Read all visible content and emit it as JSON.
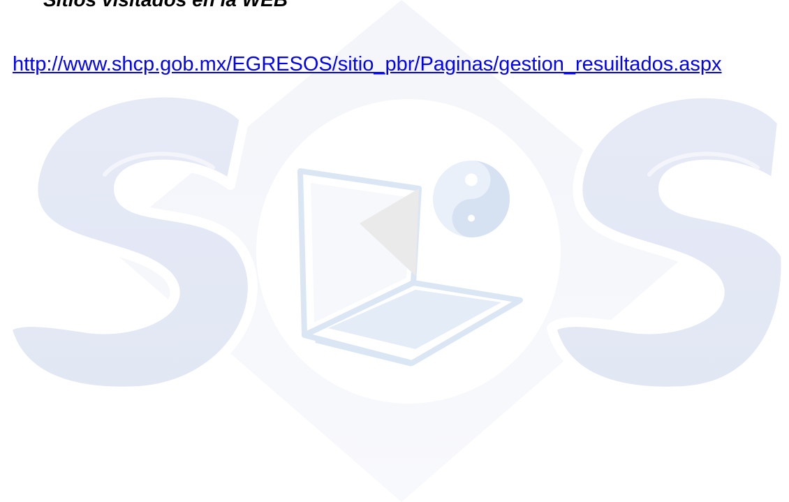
{
  "document": {
    "heading": "Sitios visitados en la WEB",
    "link_url": "http://www.shcp.gob.mx/EGRESOS/sitio_pbr/Paginas/gestion_resuiltados.aspx"
  },
  "watermark": {
    "logo_text": "SOS",
    "colors": {
      "letter_fill": "#e4e9f6",
      "diamond": "#f4f6fb",
      "circle": "#ffffff",
      "laptop": "#dfe9f5",
      "yin_yang": "#d8e4f3"
    }
  }
}
